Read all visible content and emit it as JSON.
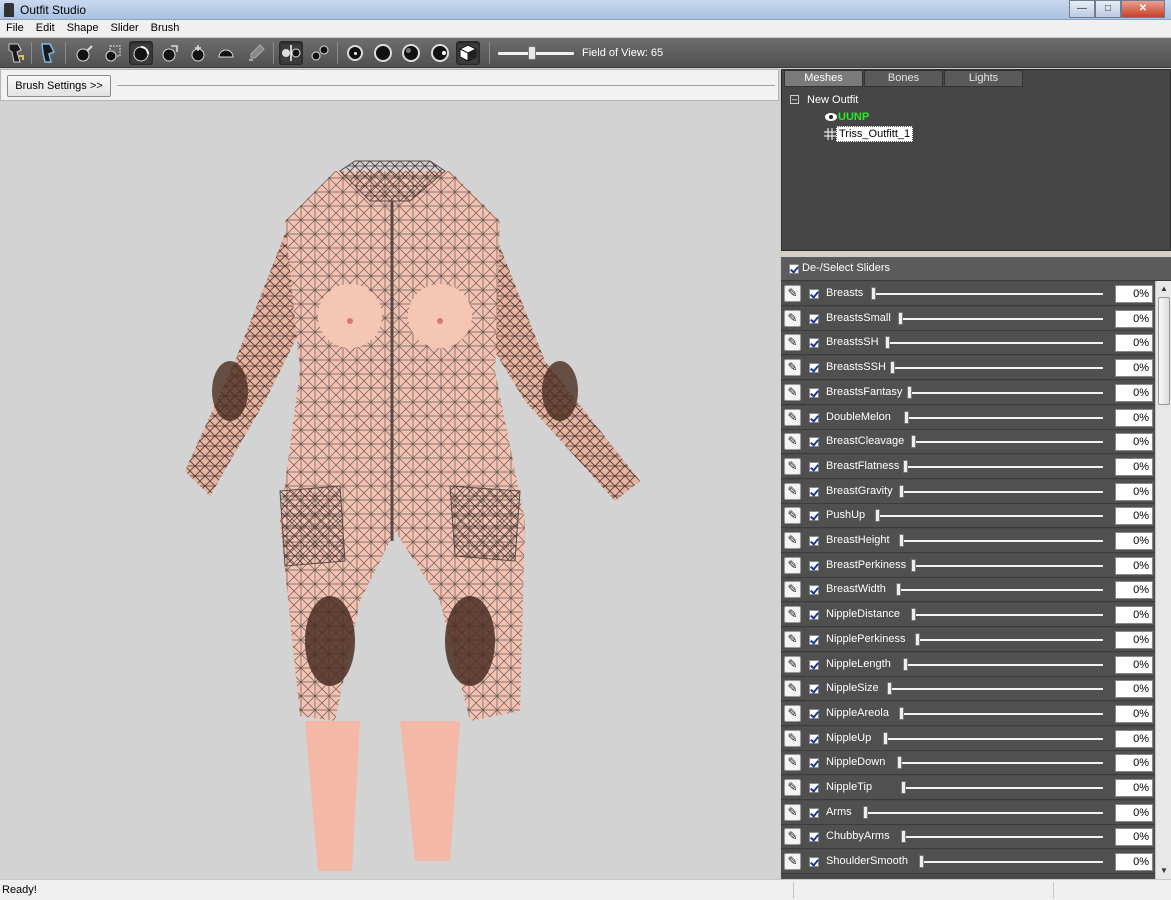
{
  "window": {
    "title": "Outfit Studio",
    "buttons": [
      "minimize-icon",
      "maximize-icon",
      "close-icon"
    ]
  },
  "menu": [
    "File",
    "Edit",
    "Shape",
    "Slider",
    "Brush"
  ],
  "toolbar": {
    "tools": [
      "select-tool-icon",
      "transform-tool-icon",
      "inflate-brush-icon",
      "mask-brush-icon",
      "deflate-brush-icon",
      "move-brush-icon",
      "smooth-brush-icon",
      "weight-brush-icon",
      "paint-brush-icon",
      "mirror-x-icon",
      "connected-only-icon",
      "vertex-dots-icon",
      "wireframe-icon",
      "lighting-icon",
      "textures-icon",
      "cube-view-icon"
    ],
    "fov_label": "Field of View: 65",
    "fov_value": 65
  },
  "brush": {
    "settings_label": "Brush Settings >>"
  },
  "mesh_panel": {
    "tabs": [
      "Meshes",
      "Bones",
      "Lights"
    ],
    "active_tab": "Meshes",
    "project": "New Outfit",
    "reference": "UUNP",
    "outfit": "Triss_Outfitt_1"
  },
  "sliders_header": {
    "label": "De-/Select Sliders"
  },
  "sliders": [
    {
      "name": "Breasts",
      "value": "0%"
    },
    {
      "name": "BreastsSmall",
      "value": "0%"
    },
    {
      "name": "BreastsSH",
      "value": "0%"
    },
    {
      "name": "BreastsSSH",
      "value": "0%"
    },
    {
      "name": "BreastsFantasy",
      "value": "0%"
    },
    {
      "name": "DoubleMelon",
      "value": "0%"
    },
    {
      "name": "BreastCleavage",
      "value": "0%"
    },
    {
      "name": "BreastFlatness",
      "value": "0%"
    },
    {
      "name": "BreastGravity",
      "value": "0%"
    },
    {
      "name": "PushUp",
      "value": "0%"
    },
    {
      "name": "BreastHeight",
      "value": "0%"
    },
    {
      "name": "BreastPerkiness",
      "value": "0%"
    },
    {
      "name": "BreastWidth",
      "value": "0%"
    },
    {
      "name": "NippleDistance",
      "value": "0%"
    },
    {
      "name": "NipplePerkiness",
      "value": "0%"
    },
    {
      "name": "NippleLength",
      "value": "0%"
    },
    {
      "name": "NippleSize",
      "value": "0%"
    },
    {
      "name": "NippleAreola",
      "value": "0%"
    },
    {
      "name": "NippleUp",
      "value": "0%"
    },
    {
      "name": "NippleDown",
      "value": "0%"
    },
    {
      "name": "NippleTip",
      "value": "0%"
    },
    {
      "name": "Arms",
      "value": "0%"
    },
    {
      "name": "ChubbyArms",
      "value": "0%"
    },
    {
      "name": "ShoulderSmooth",
      "value": "0%"
    }
  ],
  "status": {
    "text": "Ready!"
  },
  "colors": {
    "toolbar": "#5a5a5a",
    "viewport": "#d3d3d3",
    "mesh_panel": "#464646",
    "slider_row": "#505050",
    "reference_mesh": "#22ee22"
  }
}
